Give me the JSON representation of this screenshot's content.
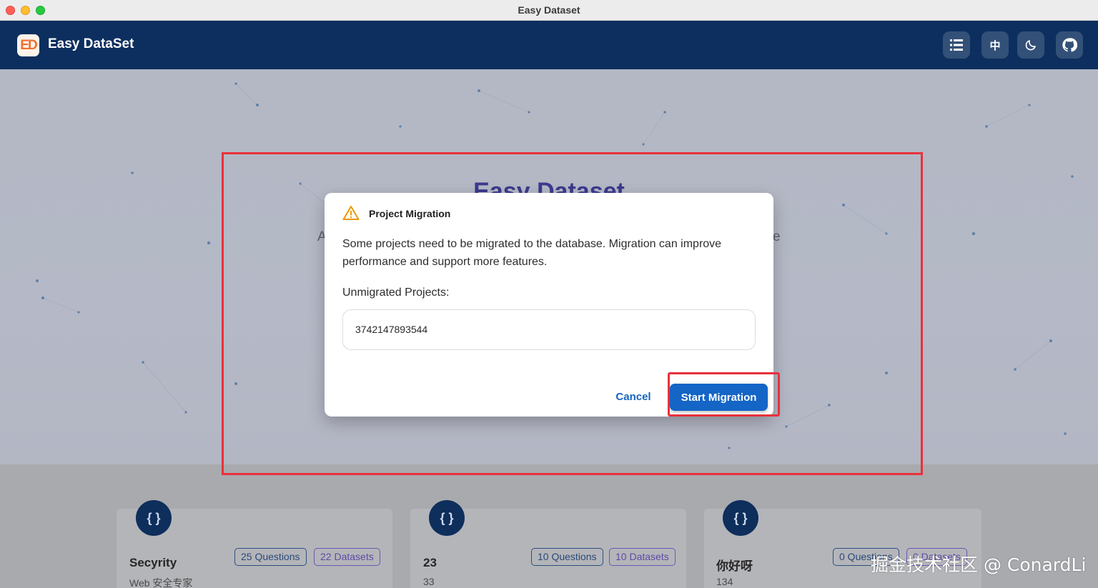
{
  "window": {
    "title": "Easy Dataset"
  },
  "appbar": {
    "logo_text": "ED",
    "name": "Easy DataSet",
    "buttons": [
      {
        "icon": "list-icon"
      },
      {
        "icon": "language-icon",
        "label": "中"
      },
      {
        "icon": "moon-icon"
      },
      {
        "icon": "github-icon"
      }
    ]
  },
  "hero": {
    "title": "Easy Dataset",
    "subtitle_left": "A",
    "subtitle_right": "e"
  },
  "dialog": {
    "title": "Project Migration",
    "message": "Some projects need to be migrated to the database. Migration can improve performance and support more features.",
    "unmigrated_label": "Unmigrated Projects:",
    "projects": [
      "3742147893544"
    ],
    "cancel_label": "Cancel",
    "start_label": "Start Migration"
  },
  "projects": [
    {
      "name": "Secyrity",
      "description": "Web 安全专家",
      "questions": "25 Questions",
      "datasets": "22 Datasets"
    },
    {
      "name": "23",
      "description": "33",
      "questions": "10 Questions",
      "datasets": "10 Datasets"
    },
    {
      "name": "你好呀",
      "description": "134",
      "questions": "0 Questions",
      "datasets": "0 Datasets"
    }
  ],
  "watermark": "掘金技术社区 @ ConardLi",
  "colors": {
    "header": "#0d2f5f",
    "accent": "#1465c6",
    "highlight": "#e8313b"
  }
}
